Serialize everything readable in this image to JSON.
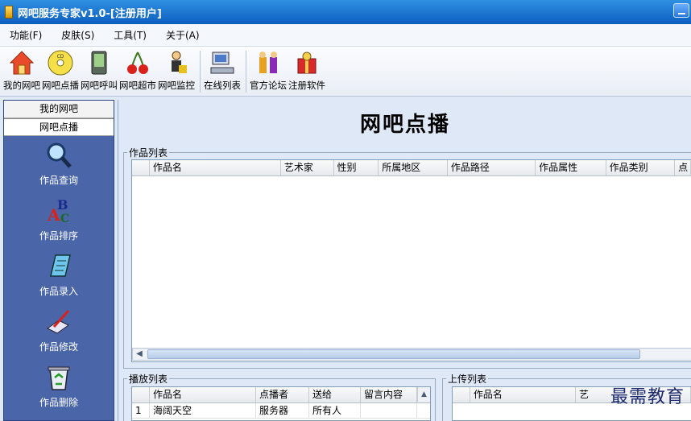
{
  "window": {
    "title": "网吧服务专家v1.0-[注册用户]"
  },
  "menu": [
    "功能(F)",
    "皮肤(S)",
    "工具(T)",
    "关于(A)"
  ],
  "toolbar": [
    {
      "label": "我的网吧",
      "icon": "house-icon"
    },
    {
      "label": "网吧点播",
      "icon": "cd-icon"
    },
    {
      "label": "网吧呼叫",
      "icon": "pda-icon"
    },
    {
      "label": "网吧超市",
      "icon": "cherry-icon"
    },
    {
      "label": "网吧监控",
      "icon": "person-icon"
    },
    {
      "label": "在线列表",
      "icon": "computer-icon"
    },
    {
      "label": "官方论坛",
      "icon": "people-icon"
    },
    {
      "label": "注册软件",
      "icon": "gift-icon"
    }
  ],
  "nav": {
    "tabs": [
      "我的网吧",
      "网吧点播"
    ],
    "entries": [
      {
        "label": "作品查询",
        "icon": "magnifier-icon"
      },
      {
        "label": "作品排序",
        "icon": "abc-sort-icon"
      },
      {
        "label": "作品录入",
        "icon": "notebook-icon"
      },
      {
        "label": "作品修改",
        "icon": "pen-edit-icon"
      },
      {
        "label": "作品删除",
        "icon": "recycle-bin-icon"
      }
    ]
  },
  "main": {
    "title": "网吧点播",
    "works_list": {
      "legend": "作品列表",
      "columns": [
        "作品名",
        "艺术家",
        "性别",
        "所属地区",
        "作品路径",
        "作品属性",
        "作品类别",
        "点"
      ]
    },
    "play_list": {
      "legend": "播放列表",
      "columns": [
        "作品名",
        "点播者",
        "送给",
        "留言内容"
      ],
      "rows": [
        [
          "1",
          "海阔天空",
          "服务器",
          "所有人",
          ""
        ]
      ]
    },
    "upload_list": {
      "legend": "上传列表",
      "columns": [
        "作品名",
        "艺"
      ]
    }
  },
  "watermark": "最需教育",
  "colors": {
    "title_bar": "#1470d0",
    "nav_bg": "#4a66a8",
    "panel_bg": "#dfe8f6"
  }
}
